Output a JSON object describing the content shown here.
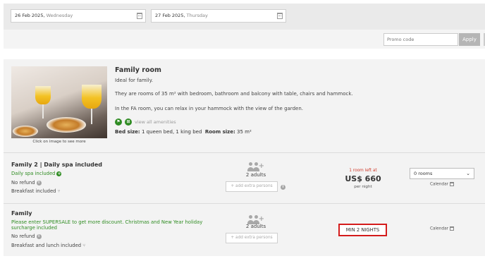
{
  "search": {
    "check_in": {
      "date": "26 Feb 2025,",
      "weekday": "Wednesday"
    },
    "check_out": {
      "date": "27 Feb 2025,",
      "weekday": "Thursday"
    },
    "promo_placeholder": "Promo code",
    "apply_label": "Apply"
  },
  "room": {
    "name": "Family room",
    "tagline": "Ideal for family.",
    "description": "They are rooms of 35 m² with bedroom, bathroom and balcony with table, chairs and hammock.",
    "note": "In the FA room, you can relax in your hammock with the view of the garden.",
    "amenities_link": "view all amenities",
    "bed_size_label": "Bed size:",
    "bed_size_value": "1 queen bed, 1 king bed",
    "room_size_label": "Room size:",
    "room_size_value": "35 m²",
    "photo_caption": "Click on image to see more"
  },
  "rates": [
    {
      "name": "Family 2 | Daily spa included",
      "highlight": "Daily spa included",
      "refund": "No refund",
      "meals": "Breakfast included",
      "adults": "2 adults",
      "extra_persons": "add extra persons",
      "rooms_left": "1 room left at",
      "price": "US$ 660",
      "per_night": "per night",
      "rooms_select": "0 rooms",
      "calendar": "Calendar"
    },
    {
      "name": "Family",
      "highlight": "Please enter SUPERSALE to get more discount. Christmas and New Year holiday surcharge included",
      "refund": "No refund",
      "meals": "Breakfast and lunch included",
      "adults": "2 adults",
      "extra_persons": "add extra persons",
      "min_stay": "MIN 2 NIGHTS",
      "calendar": "Calendar"
    }
  ],
  "colors": {
    "accent_green": "#2f8c22",
    "alert_red": "#d41c1c",
    "price_red": "#d03a2a"
  }
}
